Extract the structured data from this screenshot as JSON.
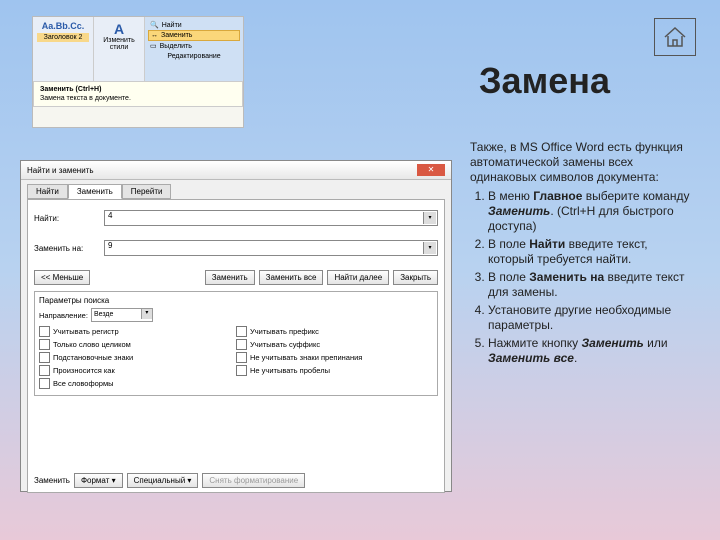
{
  "slide_title": "Замена",
  "home_icon_name": "home-icon",
  "ribbon": {
    "style_preview": "Aa.Bb.Cc.",
    "style_label": "Заголовок 2",
    "change_label": "Изменить стили",
    "find_label": "Найти",
    "replace_label": "Заменить",
    "select_label": "Выделить",
    "section_label": "Редактирование",
    "tooltip_title": "Заменить (Ctrl+H)",
    "tooltip_text": "Замена текста в документе."
  },
  "dialog": {
    "title": "Найти и заменить",
    "tabs": [
      "Найти",
      "Заменить",
      "Перейти"
    ],
    "active_tab": 1,
    "find_label": "Найти:",
    "find_value": "4",
    "replace_label": "Заменить на:",
    "replace_value": "9",
    "btn_less": "<< Меньше",
    "btn_replace": "Заменить",
    "btn_replace_all": "Заменить все",
    "btn_find_next": "Найти далее",
    "btn_close": "Закрыть",
    "params_title": "Параметры поиска",
    "direction_label": "Направление:",
    "direction_value": "Везде",
    "checks_left": [
      "Учитывать регистр",
      "Только слово целиком",
      "Подстановочные знаки",
      "Произносится как",
      "Все словоформы"
    ],
    "checks_right": [
      "Учитывать префикс",
      "Учитывать суффикс",
      "Не учитывать знаки препинания",
      "Не учитывать пробелы"
    ],
    "bottom_label": "Заменить",
    "btn_format": "Формат",
    "btn_special": "Специальный",
    "btn_noformat": "Снять форматирование"
  },
  "text": {
    "intro": "Также, в MS Office Word есть функция автоматической замены всех одинаковых символов документа:",
    "steps": [
      {
        "pre": "В меню ",
        "bold": "Главное",
        "mid": " выберите команду ",
        "bi": "Заменить",
        "post": ". (Ctrl+H для быстрого доступа)"
      },
      {
        "pre": "В поле ",
        "bold": "Найти",
        "post": " введите текст, который требуется найти."
      },
      {
        "pre": "В поле ",
        "bold": "Заменить на",
        "post": " введите текст для замены."
      },
      {
        "plain": "Установите другие необходимые параметры."
      },
      {
        "pre": "Нажмите кнопку ",
        "bi": "Заменить",
        "mid": " или ",
        "bi2": "Заменить все",
        "post": "."
      }
    ]
  }
}
